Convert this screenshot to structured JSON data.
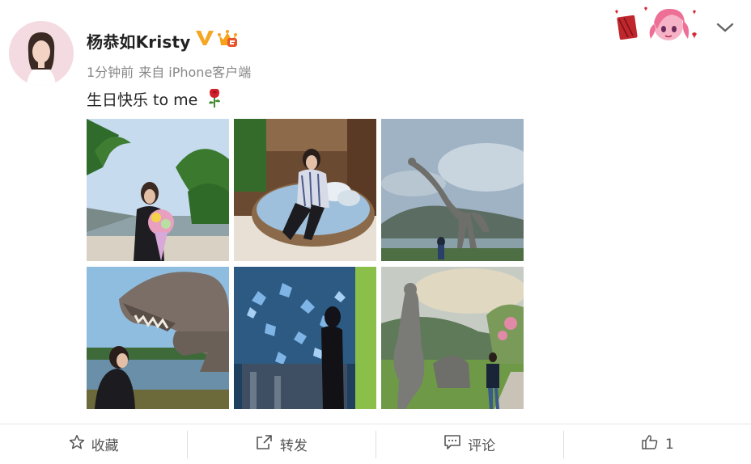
{
  "post": {
    "username": "杨恭如Kristy",
    "time": "1分钟前",
    "source": "来自 iPhone客户端",
    "text": "生日快乐 to me",
    "emoji": "rose-icon"
  },
  "icons": {
    "verified": "verified-v-icon",
    "vip": "vip-crown-icon",
    "more": "chevron-down-icon",
    "decoration": "card-decoration-anime-girl"
  },
  "photos": [
    {
      "id": "photo-1",
      "subject": "woman with bouquet by palm trees"
    },
    {
      "id": "photo-2",
      "subject": "woman on round swing bed"
    },
    {
      "id": "photo-3",
      "subject": "dinosaur statue by the sea"
    },
    {
      "id": "photo-4",
      "subject": "woman with t-rex statue"
    },
    {
      "id": "photo-5",
      "subject": "woman in blue aquarium exhibit"
    },
    {
      "id": "photo-6",
      "subject": "dinosaur statues on lawn"
    }
  ],
  "actions": {
    "favorite": "收藏",
    "repost": "转发",
    "comment": "评论",
    "like_count": "1"
  },
  "colors": {
    "verified": "#f5a623",
    "meta_text": "#888888",
    "action_text": "#555555"
  }
}
